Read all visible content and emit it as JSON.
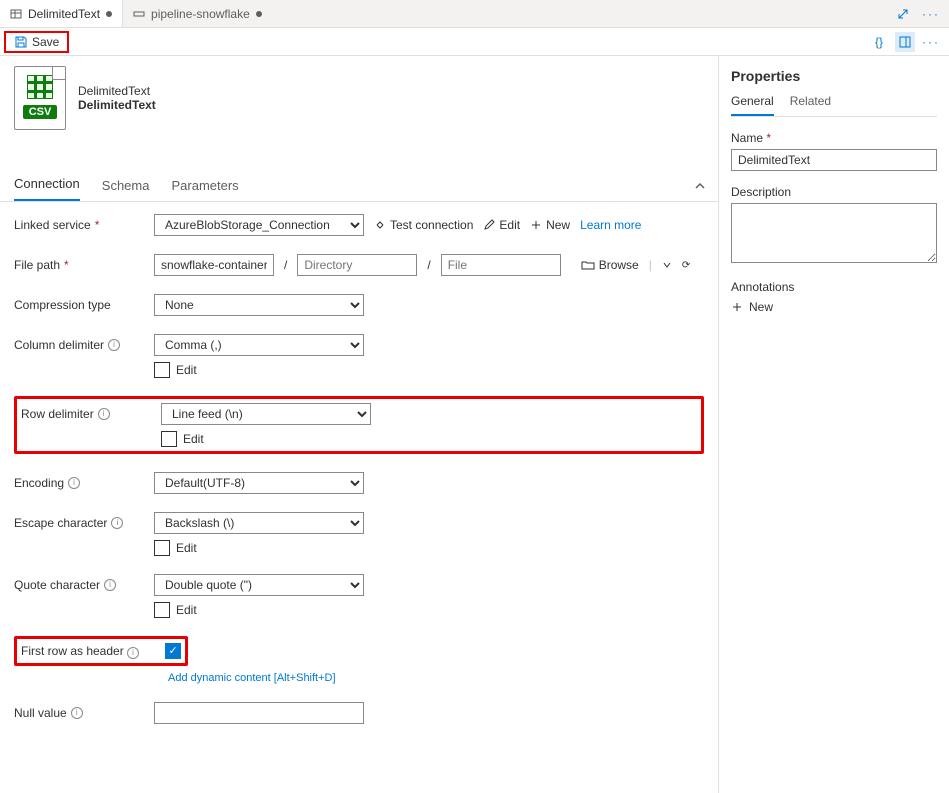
{
  "tabs": {
    "t1": {
      "label": "DelimitedText"
    },
    "t2": {
      "label": "pipeline-snowflake"
    }
  },
  "toolbar": {
    "save": "Save"
  },
  "dataset": {
    "type_label": "DelimitedText",
    "name_bold": "DelimitedText",
    "csv_badge": "CSV"
  },
  "sectionTabs": {
    "connection": "Connection",
    "schema": "Schema",
    "parameters": "Parameters"
  },
  "form": {
    "linked_service": {
      "label": "Linked service",
      "value": "AzureBlobStorage_Connection",
      "test": "Test connection",
      "edit": "Edit",
      "new": "New",
      "learn": "Learn more"
    },
    "file_path": {
      "label": "File path",
      "container": "snowflake-container",
      "directory_ph": "Directory",
      "file_ph": "File",
      "browse": "Browse"
    },
    "compression": {
      "label": "Compression type",
      "value": "None"
    },
    "col_delim": {
      "label": "Column delimiter",
      "value": "Comma (,)",
      "edit": "Edit"
    },
    "row_delim": {
      "label": "Row delimiter",
      "value": "Line feed (\\n)",
      "edit": "Edit"
    },
    "encoding": {
      "label": "Encoding",
      "value": "Default(UTF-8)"
    },
    "escape": {
      "label": "Escape character",
      "value": "Backslash (\\)",
      "edit": "Edit"
    },
    "quote": {
      "label": "Quote character",
      "value": "Double quote (\")",
      "edit": "Edit"
    },
    "first_row": {
      "label": "First row as header",
      "dyn": "Add dynamic content [Alt+Shift+D]"
    },
    "null_value": {
      "label": "Null value"
    }
  },
  "properties": {
    "title": "Properties",
    "tab_general": "General",
    "tab_related": "Related",
    "name_label": "Name",
    "name_value": "DelimitedText",
    "desc_label": "Description",
    "annot_label": "Annotations",
    "new_label": "New"
  }
}
